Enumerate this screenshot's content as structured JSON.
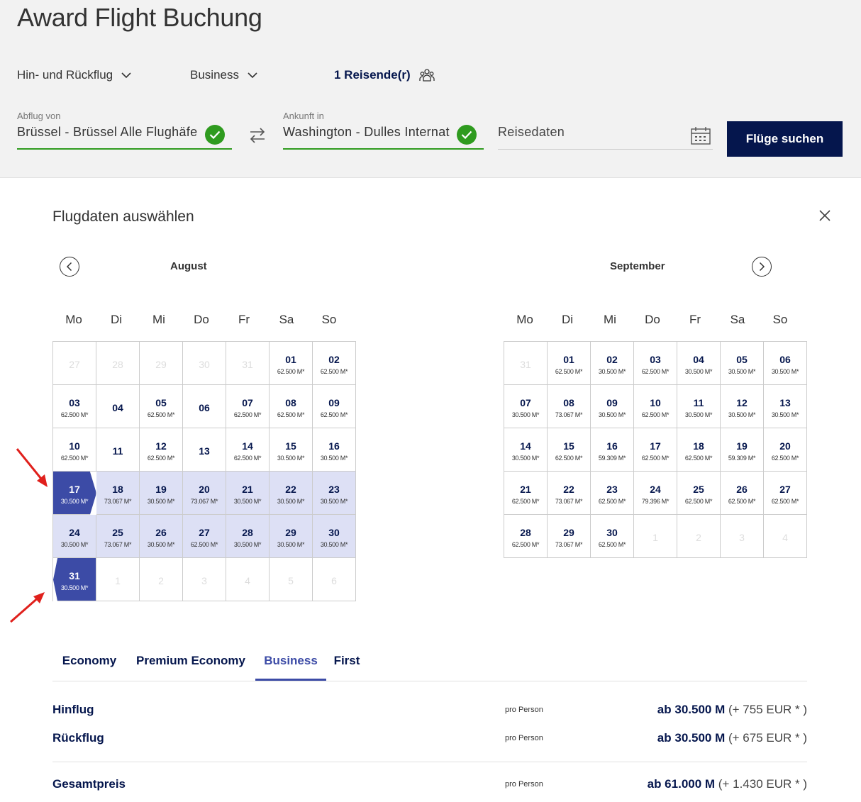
{
  "header": {
    "title": "Award Flight Buchung",
    "trip_type": "Hin- und Rückflug",
    "cabin": "Business",
    "travelers": "1 Reisende(r)"
  },
  "search": {
    "from_label": "Abflug von",
    "from_value": "Brüssel - Brüssel Alle Flughäfe",
    "to_label": "Ankunft in",
    "to_value": "Washington - Dulles Internat",
    "dates_placeholder": "Reisedaten",
    "submit_label": "Flüge suchen"
  },
  "calendar": {
    "title": "Flugdaten auswählen",
    "weekdays": [
      "Mo",
      "Di",
      "Mi",
      "Do",
      "Fr",
      "Sa",
      "So"
    ],
    "months": [
      {
        "name": "August",
        "days": [
          {
            "d": "27",
            "p": "",
            "state": "inactive"
          },
          {
            "d": "28",
            "p": "",
            "state": "inactive"
          },
          {
            "d": "29",
            "p": "",
            "state": "inactive"
          },
          {
            "d": "30",
            "p": "",
            "state": "inactive"
          },
          {
            "d": "31",
            "p": "",
            "state": "inactive"
          },
          {
            "d": "01",
            "p": "62.500 M*",
            "state": ""
          },
          {
            "d": "02",
            "p": "62.500 M*",
            "state": ""
          },
          {
            "d": "03",
            "p": "62.500 M*",
            "state": ""
          },
          {
            "d": "04",
            "p": "",
            "state": ""
          },
          {
            "d": "05",
            "p": "62.500 M*",
            "state": ""
          },
          {
            "d": "06",
            "p": "",
            "state": ""
          },
          {
            "d": "07",
            "p": "62.500 M*",
            "state": ""
          },
          {
            "d": "08",
            "p": "62.500 M*",
            "state": ""
          },
          {
            "d": "09",
            "p": "62.500 M*",
            "state": ""
          },
          {
            "d": "10",
            "p": "62.500 M*",
            "state": ""
          },
          {
            "d": "11",
            "p": "",
            "state": ""
          },
          {
            "d": "12",
            "p": "62.500 M*",
            "state": ""
          },
          {
            "d": "13",
            "p": "",
            "state": ""
          },
          {
            "d": "14",
            "p": "62.500 M*",
            "state": ""
          },
          {
            "d": "15",
            "p": "30.500 M*",
            "state": ""
          },
          {
            "d": "16",
            "p": "30.500 M*",
            "state": ""
          },
          {
            "d": "17",
            "p": "30.500 M*",
            "state": "sel sel-start"
          },
          {
            "d": "18",
            "p": "73.067 M*",
            "state": "range"
          },
          {
            "d": "19",
            "p": "30.500 M*",
            "state": "range"
          },
          {
            "d": "20",
            "p": "73.067 M*",
            "state": "range"
          },
          {
            "d": "21",
            "p": "30.500 M*",
            "state": "range"
          },
          {
            "d": "22",
            "p": "30.500 M*",
            "state": "range"
          },
          {
            "d": "23",
            "p": "30.500 M*",
            "state": "range"
          },
          {
            "d": "24",
            "p": "30.500 M*",
            "state": "range"
          },
          {
            "d": "25",
            "p": "73.067 M*",
            "state": "range"
          },
          {
            "d": "26",
            "p": "30.500 M*",
            "state": "range"
          },
          {
            "d": "27",
            "p": "62.500 M*",
            "state": "range"
          },
          {
            "d": "28",
            "p": "30.500 M*",
            "state": "range"
          },
          {
            "d": "29",
            "p": "30.500 M*",
            "state": "range"
          },
          {
            "d": "30",
            "p": "30.500 M*",
            "state": "range"
          },
          {
            "d": "31",
            "p": "30.500 M*",
            "state": "sel sel-end"
          },
          {
            "d": "1",
            "p": "",
            "state": "inactive"
          },
          {
            "d": "2",
            "p": "",
            "state": "inactive"
          },
          {
            "d": "3",
            "p": "",
            "state": "inactive"
          },
          {
            "d": "4",
            "p": "",
            "state": "inactive"
          },
          {
            "d": "5",
            "p": "",
            "state": "inactive"
          },
          {
            "d": "6",
            "p": "",
            "state": "inactive"
          }
        ]
      },
      {
        "name": "September",
        "days": [
          {
            "d": "31",
            "p": "",
            "state": "inactive"
          },
          {
            "d": "01",
            "p": "62.500 M*",
            "state": ""
          },
          {
            "d": "02",
            "p": "30.500 M*",
            "state": ""
          },
          {
            "d": "03",
            "p": "62.500 M*",
            "state": ""
          },
          {
            "d": "04",
            "p": "30.500 M*",
            "state": ""
          },
          {
            "d": "05",
            "p": "30.500 M*",
            "state": ""
          },
          {
            "d": "06",
            "p": "30.500 M*",
            "state": ""
          },
          {
            "d": "07",
            "p": "30.500 M*",
            "state": ""
          },
          {
            "d": "08",
            "p": "73.067 M*",
            "state": ""
          },
          {
            "d": "09",
            "p": "30.500 M*",
            "state": ""
          },
          {
            "d": "10",
            "p": "62.500 M*",
            "state": ""
          },
          {
            "d": "11",
            "p": "30.500 M*",
            "state": ""
          },
          {
            "d": "12",
            "p": "30.500 M*",
            "state": ""
          },
          {
            "d": "13",
            "p": "30.500 M*",
            "state": ""
          },
          {
            "d": "14",
            "p": "30.500 M*",
            "state": ""
          },
          {
            "d": "15",
            "p": "62.500 M*",
            "state": ""
          },
          {
            "d": "16",
            "p": "59.309 M*",
            "state": ""
          },
          {
            "d": "17",
            "p": "62.500 M*",
            "state": ""
          },
          {
            "d": "18",
            "p": "62.500 M*",
            "state": ""
          },
          {
            "d": "19",
            "p": "59.309 M*",
            "state": ""
          },
          {
            "d": "20",
            "p": "62.500 M*",
            "state": ""
          },
          {
            "d": "21",
            "p": "62.500 M*",
            "state": ""
          },
          {
            "d": "22",
            "p": "73.067 M*",
            "state": ""
          },
          {
            "d": "23",
            "p": "62.500 M*",
            "state": ""
          },
          {
            "d": "24",
            "p": "79.396 M*",
            "state": ""
          },
          {
            "d": "25",
            "p": "62.500 M*",
            "state": ""
          },
          {
            "d": "26",
            "p": "62.500 M*",
            "state": ""
          },
          {
            "d": "27",
            "p": "62.500 M*",
            "state": ""
          },
          {
            "d": "28",
            "p": "62.500 M*",
            "state": ""
          },
          {
            "d": "29",
            "p": "73.067 M*",
            "state": ""
          },
          {
            "d": "30",
            "p": "62.500 M*",
            "state": ""
          },
          {
            "d": "1",
            "p": "",
            "state": "inactive"
          },
          {
            "d": "2",
            "p": "",
            "state": "inactive"
          },
          {
            "d": "3",
            "p": "",
            "state": "inactive"
          },
          {
            "d": "4",
            "p": "",
            "state": "inactive"
          }
        ]
      }
    ]
  },
  "cabin_tabs": [
    "Economy",
    "Premium Economy",
    "Business",
    "First"
  ],
  "active_tab": "Business",
  "prices": [
    {
      "label": "Hinflug",
      "per": "pro Person",
      "main": "ab 30.500 M",
      "extra": " (+ 755 EUR * )"
    },
    {
      "label": "Rückflug",
      "per": "pro Person",
      "main": "ab 30.500 M",
      "extra": " (+ 675 EUR * )"
    },
    {
      "label": "Gesamtpreis",
      "per": "pro Person",
      "main": "ab 61.000 M",
      "extra": " (+ 1.430 EUR * )"
    }
  ],
  "colors": {
    "navy": "#05164d",
    "selected": "#3c4ba6",
    "range": "#dde0f5",
    "valid": "#2f9b1f",
    "annotation": "#e0201c"
  }
}
